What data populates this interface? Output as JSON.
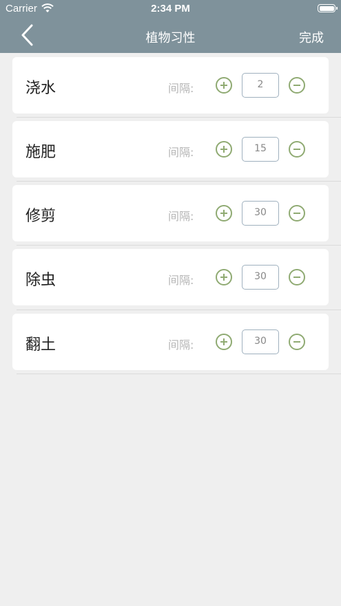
{
  "status_bar": {
    "carrier": "Carrier",
    "time": "2:34 PM"
  },
  "nav": {
    "title": "植物习性",
    "done_label": "完成"
  },
  "interval_label": "间隔:",
  "items": [
    {
      "label": "浇水",
      "value": "2"
    },
    {
      "label": "施肥",
      "value": "15"
    },
    {
      "label": "修剪",
      "value": "30"
    },
    {
      "label": "除虫",
      "value": "30"
    },
    {
      "label": "翻土",
      "value": "30"
    }
  ]
}
